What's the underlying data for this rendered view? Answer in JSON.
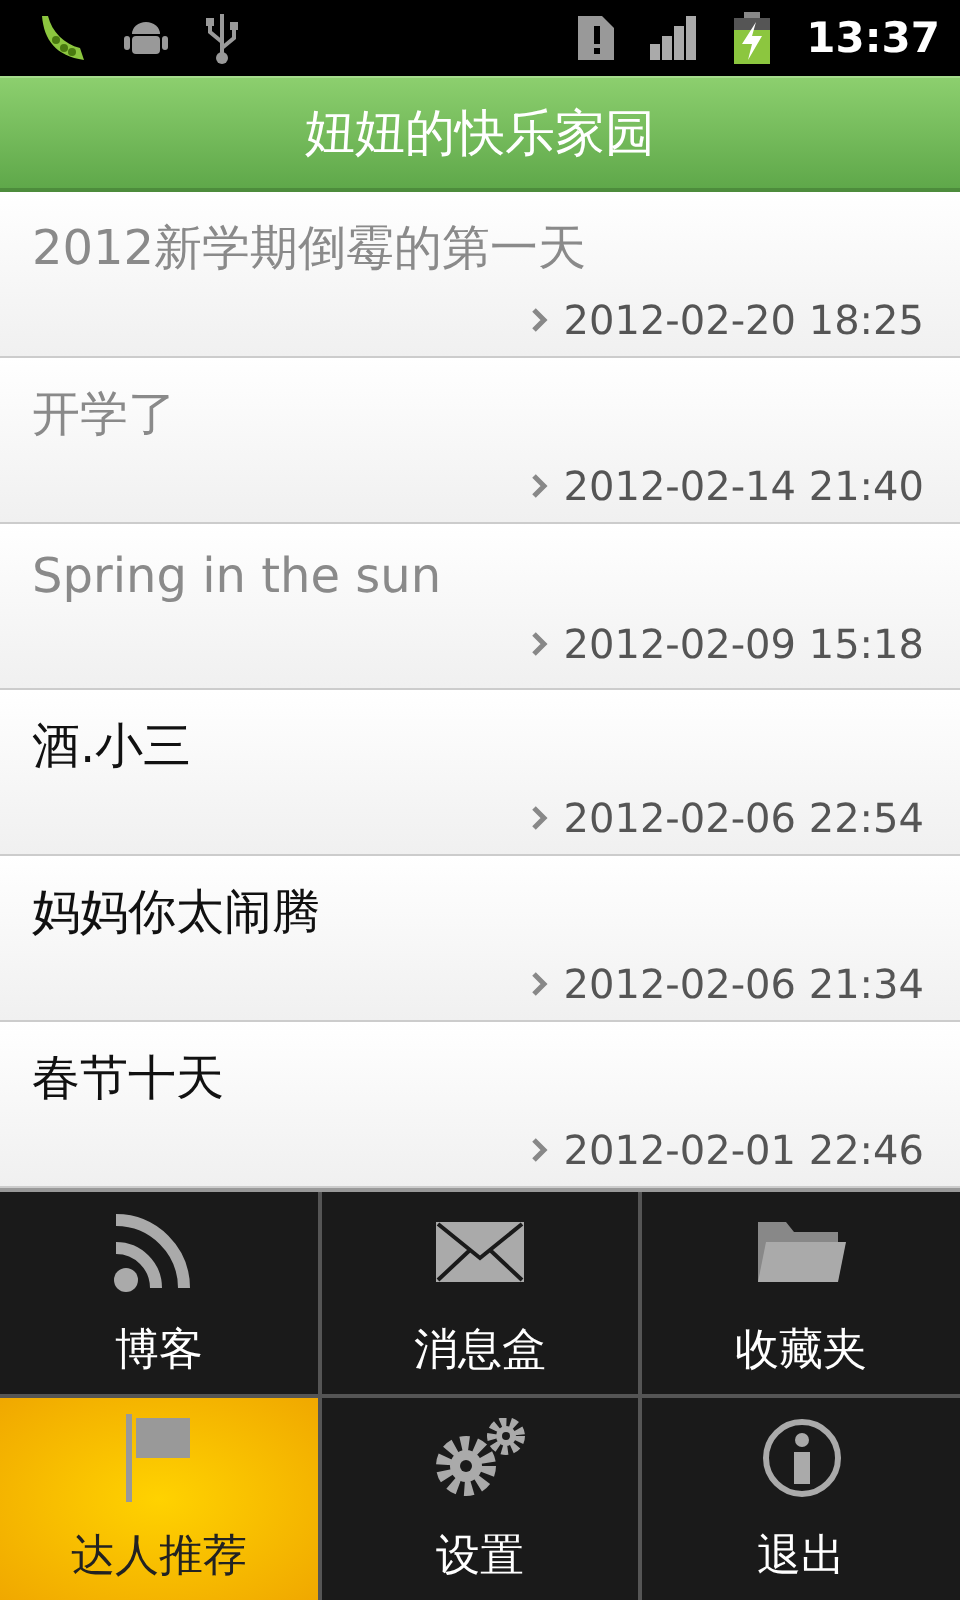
{
  "status_bar": {
    "time": "13:37"
  },
  "title_bar": {
    "title": "妞妞的快乐家园"
  },
  "posts": [
    {
      "title": "2012新学期倒霉的第一天",
      "date": "2012-02-20 18:25",
      "read": true
    },
    {
      "title": "开学了",
      "date": "2012-02-14 21:40",
      "read": true
    },
    {
      "title": "Spring in the sun",
      "date": "2012-02-09 15:18",
      "read": true
    },
    {
      "title": "酒.小三",
      "date": "2012-02-06 22:54",
      "read": false
    },
    {
      "title": "妈妈你太闹腾",
      "date": "2012-02-06 21:34",
      "read": false
    },
    {
      "title": "春节十天",
      "date": "2012-02-01 22:46",
      "read": false
    }
  ],
  "menu": [
    {
      "label": "博客",
      "selected": false
    },
    {
      "label": "消息盒",
      "selected": false
    },
    {
      "label": "收藏夹",
      "selected": false
    },
    {
      "label": "达人推荐",
      "selected": true
    },
    {
      "label": "设置",
      "selected": false
    },
    {
      "label": "退出",
      "selected": false
    }
  ]
}
